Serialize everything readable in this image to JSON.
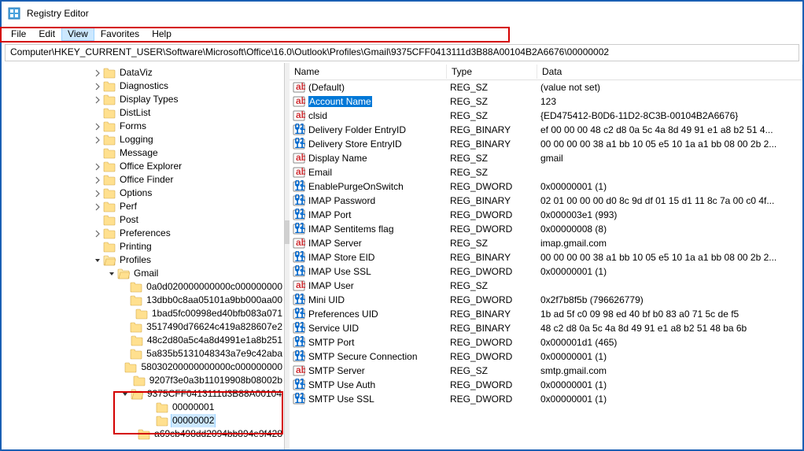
{
  "window": {
    "title": "Registry Editor"
  },
  "menu": {
    "file": "File",
    "edit": "Edit",
    "view": "View",
    "favorites": "Favorites",
    "help": "Help"
  },
  "address": "Computer\\HKEY_CURRENT_USER\\Software\\Microsoft\\Office\\16.0\\Outlook\\Profiles\\Gmail\\9375CFF0413111d3B88A00104B2A6676\\00000002",
  "columns": {
    "name": "Name",
    "type": "Type",
    "data": "Data"
  },
  "tree": [
    {
      "indent": 115,
      "chev": ">",
      "label": "DataViz"
    },
    {
      "indent": 115,
      "chev": ">",
      "label": "Diagnostics"
    },
    {
      "indent": 115,
      "chev": ">",
      "label": "Display Types"
    },
    {
      "indent": 115,
      "chev": "",
      "label": "DistList"
    },
    {
      "indent": 115,
      "chev": ">",
      "label": "Forms"
    },
    {
      "indent": 115,
      "chev": ">",
      "label": "Logging"
    },
    {
      "indent": 115,
      "chev": "",
      "label": "Message"
    },
    {
      "indent": 115,
      "chev": ">",
      "label": "Office Explorer"
    },
    {
      "indent": 115,
      "chev": ">",
      "label": "Office Finder"
    },
    {
      "indent": 115,
      "chev": ">",
      "label": "Options"
    },
    {
      "indent": 115,
      "chev": ">",
      "label": "Perf"
    },
    {
      "indent": 115,
      "chev": "",
      "label": "Post"
    },
    {
      "indent": 115,
      "chev": ">",
      "label": "Preferences"
    },
    {
      "indent": 115,
      "chev": "",
      "label": "Printing"
    },
    {
      "indent": 115,
      "chev": "v",
      "label": "Profiles",
      "open": true
    },
    {
      "indent": 133,
      "chev": "v",
      "label": "Gmail",
      "open": true
    },
    {
      "indent": 165,
      "chev": "",
      "label": "0a0d020000000000c000000000"
    },
    {
      "indent": 165,
      "chev": "",
      "label": "13dbb0c8aa05101a9bb000aa00"
    },
    {
      "indent": 165,
      "chev": "",
      "label": "1bad5fc00998ed40bfb083a071"
    },
    {
      "indent": 165,
      "chev": "",
      "label": "3517490d76624c419a828607e2"
    },
    {
      "indent": 165,
      "chev": "",
      "label": "48c2d80a5c4a8d4991e1a8b251"
    },
    {
      "indent": 165,
      "chev": "",
      "label": "5a835b5131048343a7e9c42aba"
    },
    {
      "indent": 165,
      "chev": "",
      "label": "58030200000000000c000000000"
    },
    {
      "indent": 165,
      "chev": "",
      "label": "9207f3e0a3b11019908b08002b"
    },
    {
      "indent": 150,
      "chev": "v",
      "label": "9375CFF0413111d3B88A00104",
      "open": true
    },
    {
      "indent": 182,
      "chev": "",
      "label": "00000001"
    },
    {
      "indent": 182,
      "chev": "",
      "label": "00000002",
      "selected": true
    },
    {
      "indent": 165,
      "chev": "",
      "label": "a69cb498dd2094bb894e9f428"
    }
  ],
  "values": [
    {
      "icon": "sz",
      "name": "(Default)",
      "type": "REG_SZ",
      "data": "(value not set)"
    },
    {
      "icon": "sz",
      "name": "Account Name",
      "type": "REG_SZ",
      "data": "123",
      "selected": true
    },
    {
      "icon": "sz",
      "name": "clsid",
      "type": "REG_SZ",
      "data": "{ED475412-B0D6-11D2-8C3B-00104B2A6676}"
    },
    {
      "icon": "bin",
      "name": "Delivery Folder EntryID",
      "type": "REG_BINARY",
      "data": "ef 00 00 00 48 c2 d8 0a 5c 4a 8d 49 91 e1 a8 b2 51 4..."
    },
    {
      "icon": "bin",
      "name": "Delivery Store EntryID",
      "type": "REG_BINARY",
      "data": "00 00 00 00 38 a1 bb 10 05 e5 10 1a a1 bb 08 00 2b 2..."
    },
    {
      "icon": "sz",
      "name": "Display Name",
      "type": "REG_SZ",
      "data": "gmail"
    },
    {
      "icon": "sz",
      "name": "Email",
      "type": "REG_SZ",
      "data": ""
    },
    {
      "icon": "bin",
      "name": "EnablePurgeOnSwitch",
      "type": "REG_DWORD",
      "data": "0x00000001 (1)"
    },
    {
      "icon": "bin",
      "name": "IMAP Password",
      "type": "REG_BINARY",
      "data": "02 01 00 00 00 d0 8c 9d df 01 15 d1 11 8c 7a 00 c0 4f..."
    },
    {
      "icon": "bin",
      "name": "IMAP Port",
      "type": "REG_DWORD",
      "data": "0x000003e1 (993)"
    },
    {
      "icon": "bin",
      "name": "IMAP Sentitems flag",
      "type": "REG_DWORD",
      "data": "0x00000008 (8)"
    },
    {
      "icon": "sz",
      "name": "IMAP Server",
      "type": "REG_SZ",
      "data": "imap.gmail.com"
    },
    {
      "icon": "bin",
      "name": "IMAP Store EID",
      "type": "REG_BINARY",
      "data": "00 00 00 00 38 a1 bb 10 05 e5 10 1a a1 bb 08 00 2b 2..."
    },
    {
      "icon": "bin",
      "name": "IMAP Use SSL",
      "type": "REG_DWORD",
      "data": "0x00000001 (1)"
    },
    {
      "icon": "sz",
      "name": "IMAP User",
      "type": "REG_SZ",
      "data": ""
    },
    {
      "icon": "bin",
      "name": "Mini UID",
      "type": "REG_DWORD",
      "data": "0x2f7b8f5b (796626779)"
    },
    {
      "icon": "bin",
      "name": "Preferences UID",
      "type": "REG_BINARY",
      "data": "1b ad 5f c0 09 98 ed 40 bf b0 83 a0 71 5c de f5"
    },
    {
      "icon": "bin",
      "name": "Service UID",
      "type": "REG_BINARY",
      "data": "48 c2 d8 0a 5c 4a 8d 49 91 e1 a8 b2 51 48 ba 6b"
    },
    {
      "icon": "bin",
      "name": "SMTP Port",
      "type": "REG_DWORD",
      "data": "0x000001d1 (465)"
    },
    {
      "icon": "bin",
      "name": "SMTP Secure Connection",
      "type": "REG_DWORD",
      "data": "0x00000001 (1)"
    },
    {
      "icon": "sz",
      "name": "SMTP Server",
      "type": "REG_SZ",
      "data": "smtp.gmail.com"
    },
    {
      "icon": "bin",
      "name": "SMTP Use Auth",
      "type": "REG_DWORD",
      "data": "0x00000001 (1)"
    },
    {
      "icon": "bin",
      "name": "SMTP Use SSL",
      "type": "REG_DWORD",
      "data": "0x00000001 (1)"
    }
  ]
}
